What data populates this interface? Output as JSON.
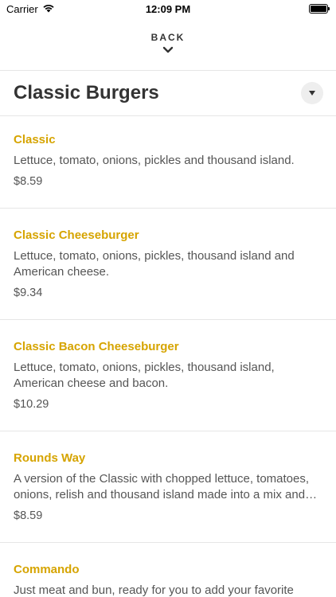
{
  "status_bar": {
    "carrier": "Carrier",
    "time": "12:09 PM",
    "battery_level": 1.0
  },
  "header": {
    "back_label": "BACK"
  },
  "category": {
    "title": "Classic Burgers"
  },
  "items": [
    {
      "name": "Classic",
      "description": "Lettuce, tomato, onions, pickles and thousand island.",
      "price": "$8.59"
    },
    {
      "name": "Classic Cheeseburger",
      "description": "Lettuce, tomato, onions, pickles, thousand island and American cheese.",
      "price": "$9.34"
    },
    {
      "name": "Classic Bacon Cheeseburger",
      "description": "Lettuce, tomato, onions, pickles, thousand island, American cheese and bacon.",
      "price": "$10.29"
    },
    {
      "name": "Rounds Way",
      "description": "A version of the Classic with chopped lettuce, tomatoes, onions, relish and thousand island made into a mix and placed on the burger.",
      "price": "$8.59"
    },
    {
      "name": "Commando",
      "description": "Just meat and bun, ready for you to add your favorite",
      "price": ""
    }
  ],
  "colors": {
    "item_name": "#d6a400",
    "divider": "#e6e6e6"
  }
}
